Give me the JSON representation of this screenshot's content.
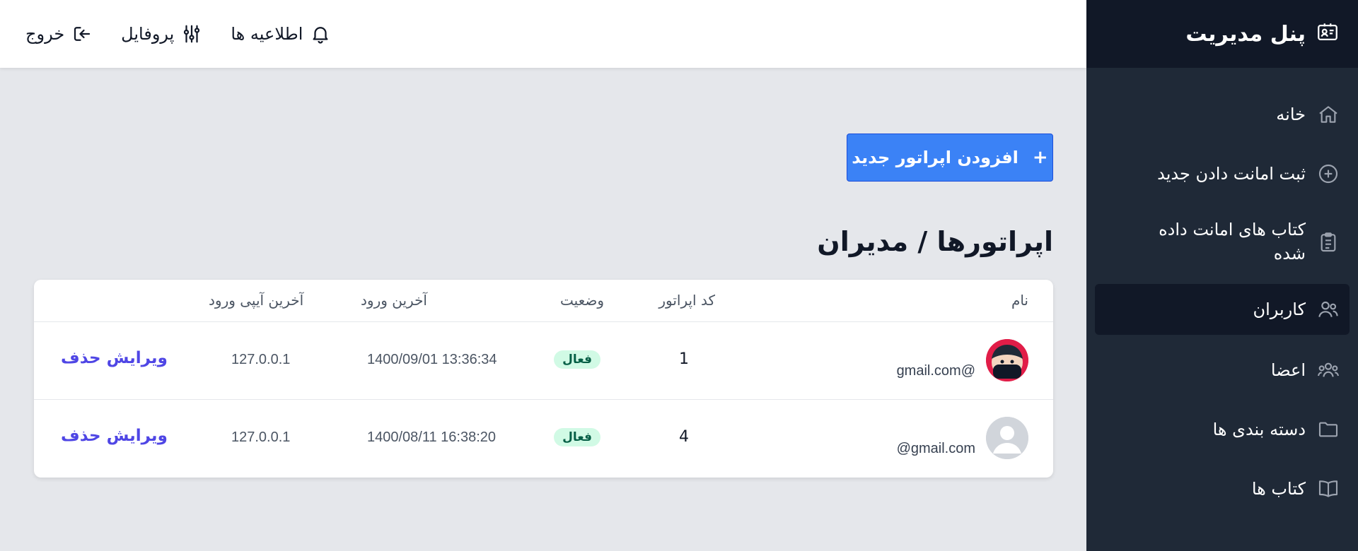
{
  "sidebar": {
    "brand": "پنل مدیریت",
    "brand_icon": "id-card-icon",
    "items": [
      {
        "label": "خانه",
        "icon": "home-icon"
      },
      {
        "label": "ثبت امانت دادن جدید",
        "icon": "plus-circle-icon"
      },
      {
        "label": "کتاب های امانت داده شده",
        "icon": "clipboard-list-icon"
      },
      {
        "label": "کاربران",
        "icon": "users-icon",
        "active": true
      },
      {
        "label": "اعضا",
        "icon": "user-group-icon"
      },
      {
        "label": "دسته بندی ها",
        "icon": "folder-icon"
      },
      {
        "label": "کتاب ها",
        "icon": "book-open-icon"
      }
    ]
  },
  "topbar": {
    "notifications": "اطلاعیه ها",
    "profile": "پروفایل",
    "logout": "خروج"
  },
  "main": {
    "add_button": "افزودن اپراتور جدید",
    "title": "اپراتورها / مدیران",
    "table": {
      "headers": {
        "name": "نام",
        "code": "کد اپراتور",
        "status": "وضعیت",
        "last_login": "آخرین ورود",
        "last_ip": "آخرین آیپی ورود"
      },
      "rows": [
        {
          "name": "",
          "email": "gmail.com@",
          "code": "1",
          "status": "فعال",
          "last_login": "1400/09/01 13:36:34",
          "ip": "127.0.0.1",
          "edit": "ویرایش",
          "delete": "حذف"
        },
        {
          "name": "",
          "email": "@gmail.com",
          "code": "4",
          "status": "فعال",
          "last_login": "1400/08/11 16:38:20",
          "ip": "127.0.0.1",
          "edit": "ویرایش",
          "delete": "حذف"
        }
      ]
    }
  },
  "colors": {
    "sidebar_bg": "#1f2937",
    "brand_bg": "#111827",
    "accent": "#3b82f6",
    "link": "#4f46e5",
    "badge_bg": "#d1fae5",
    "badge_text": "#065f46"
  }
}
